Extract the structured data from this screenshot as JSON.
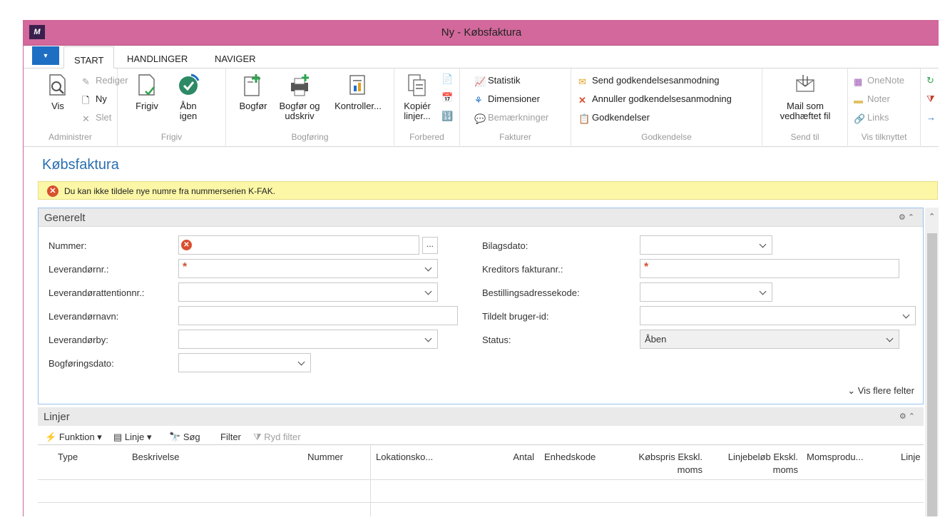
{
  "window": {
    "title": "Ny - Købsfaktura",
    "logo": "M"
  },
  "tabs": [
    "START",
    "HANDLINGER",
    "NAVIGER"
  ],
  "ribbon": {
    "administrer": {
      "label": "Administrer",
      "vis": "Vis",
      "rediger": "Rediger",
      "ny": "Ny",
      "slet": "Slet"
    },
    "frigiv": {
      "label": "Frigiv",
      "frigiv": "Frigiv",
      "aabn_1": "Åbn",
      "aabn_2": "igen"
    },
    "bogforing": {
      "label": "Bogføring",
      "bogfor": "Bogfør",
      "bogfor_udskriv_1": "Bogfør og",
      "bogfor_udskriv_2": "udskriv",
      "kontroller": "Kontroller..."
    },
    "forbered": {
      "label": "Forbered",
      "kopier_1": "Kopiér",
      "kopier_2": "linjer..."
    },
    "fakturer": {
      "label": "Fakturer",
      "statistik": "Statistik",
      "dimensioner": "Dimensioner",
      "bemaerkninger": "Bemærkninger"
    },
    "godkendelse": {
      "label": "Godkendelse",
      "send": "Send godkendelsesanmodning",
      "annuller": "Annuller godkendelsesanmodning",
      "godkendelser": "Godkendelser"
    },
    "send_til": {
      "label": "Send til",
      "mail_1": "Mail som",
      "mail_2": "vedhæftet fil"
    },
    "vis_tilknyttet": {
      "label": "Vis tilknyttet",
      "onenote": "OneNote",
      "noter": "Noter",
      "links": "Links"
    }
  },
  "page_title": "Købsfaktura",
  "error_message": "Du kan ikke tildele nye numre fra nummerserien K-FAK.",
  "general": {
    "title": "Generelt",
    "fields": {
      "nummer": "Nummer:",
      "leverandornr": "Leverandørnr.:",
      "leverandorattention": "Leverandørattentionnr.:",
      "leverandornavn": "Leverandørnavn:",
      "leverandorby": "Leverandørby:",
      "bogforingsdato": "Bogføringsdato:",
      "bilagsdato": "Bilagsdato:",
      "kreditors_fakturanr": "Kreditors fakturanr.:",
      "bestillingsadressekode": "Bestillingsadressekode:",
      "tildelt_bruger": "Tildelt bruger-id:",
      "status": "Status:"
    },
    "status_value": "Åben",
    "lookup_button": "...",
    "show_more": "Vis flere felter"
  },
  "lines": {
    "title": "Linjer",
    "toolbar": {
      "funktion": "Funktion",
      "linje": "Linje",
      "sog": "Søg",
      "filter": "Filter",
      "ryd_filter": "Ryd filter"
    },
    "columns": {
      "type": "Type",
      "beskrivelse": "Beskrivelse",
      "nummer": "Nummer",
      "lokation": "Lokationsko...",
      "antal": "Antal",
      "enhedskode": "Enhedskode",
      "kobspris_1": "Købspris Ekskl.",
      "kobspris_2": "moms",
      "linjebelob_1": "Linjebeløb Ekskl.",
      "linjebelob_2": "moms",
      "momsprodu": "Momsprodu...",
      "linje": "Linje"
    }
  },
  "colors": {
    "titlebar": "#d2689b",
    "accent": "#1e6fc4",
    "error": "#d8502f",
    "warning_bg": "#fbf7a6"
  }
}
